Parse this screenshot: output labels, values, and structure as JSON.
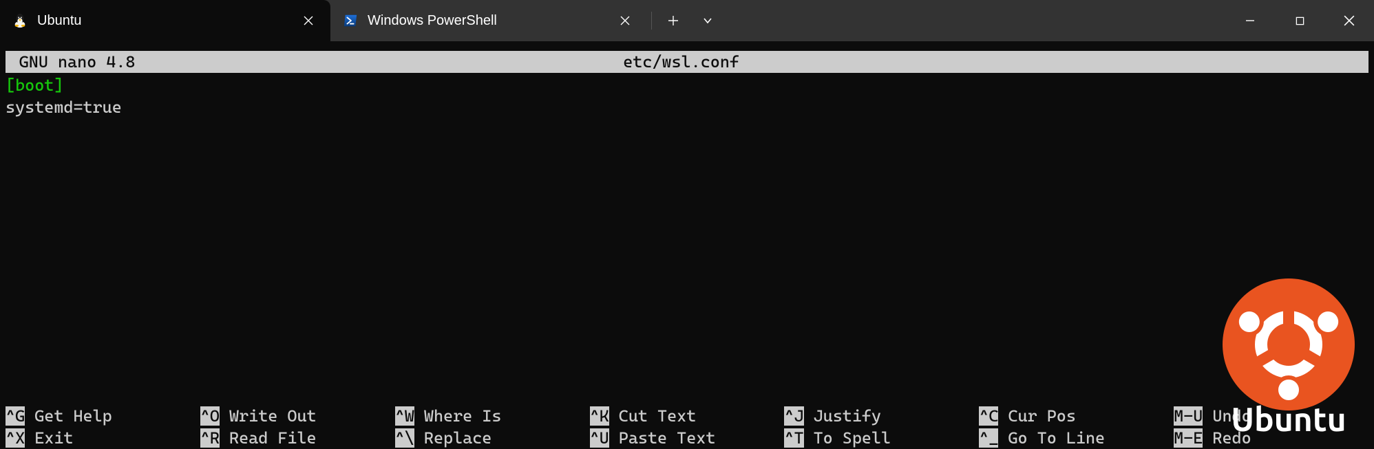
{
  "titlebar": {
    "tabs": [
      {
        "title": "Ubuntu",
        "icon": "tux-icon",
        "active": true
      },
      {
        "title": "Windows PowerShell",
        "icon": "powershell-icon",
        "active": false
      }
    ],
    "new_tab_tooltip": "+",
    "dropdown_tooltip": "v"
  },
  "nano": {
    "app_title": "GNU nano 4.8",
    "file_path": "etc/wsl.conf",
    "content": {
      "section": "[boot]",
      "line1": "systemd=true"
    },
    "shortcuts_row1": [
      {
        "key": "^G",
        "label": "Get Help"
      },
      {
        "key": "^O",
        "label": "Write Out"
      },
      {
        "key": "^W",
        "label": "Where Is"
      },
      {
        "key": "^K",
        "label": "Cut Text"
      },
      {
        "key": "^J",
        "label": "Justify"
      },
      {
        "key": "^C",
        "label": "Cur Pos"
      },
      {
        "key": "M-U",
        "label": "Undo"
      }
    ],
    "shortcuts_row2": [
      {
        "key": "^X",
        "label": "Exit"
      },
      {
        "key": "^R",
        "label": "Read File"
      },
      {
        "key": "^\\",
        "label": "Replace"
      },
      {
        "key": "^U",
        "label": "Paste Text"
      },
      {
        "key": "^T",
        "label": "To Spell"
      },
      {
        "key": "^_",
        "label": "Go To Line"
      },
      {
        "key": "M-E",
        "label": "Redo"
      }
    ]
  },
  "watermark": {
    "label": "Ubuntu",
    "brand_color": "#E95420"
  }
}
